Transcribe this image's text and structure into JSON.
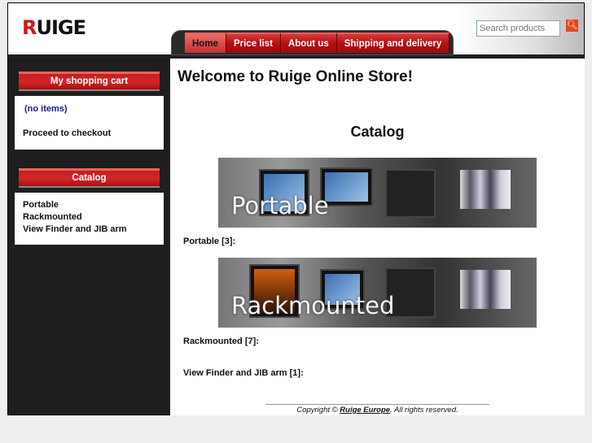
{
  "header": {
    "logo": "RUIGE",
    "logo_r": "R",
    "logo_rest": "UIGE"
  },
  "nav": [
    "Home",
    "Price list",
    "About us",
    "Shipping and delivery"
  ],
  "search": {
    "placeholder": "Search products",
    "icon": "magnifier-icon"
  },
  "sidebar": {
    "cart_title": "My shopping cart",
    "cart_empty": "(no items)",
    "checkout": "Proceed to checkout",
    "catalog_title": "Catalog",
    "categories": [
      "Portable",
      "Rackmounted",
      "View Finder and JIB arm"
    ]
  },
  "main": {
    "title": "Welcome to Ruige Online Store!",
    "catalog_heading": "Catalog",
    "banners": [
      "Portable",
      "Rackmounted"
    ],
    "categories": [
      {
        "name": "Portable",
        "count": "[3]"
      },
      {
        "name": "Rackmounted",
        "count": "[7]"
      },
      {
        "name": "View Finder and JIB arm",
        "count": "[1]"
      }
    ]
  },
  "footer": {
    "prefix": "Copyright © ",
    "link": "Ruige Europe",
    "suffix": ". All rights reserved."
  }
}
